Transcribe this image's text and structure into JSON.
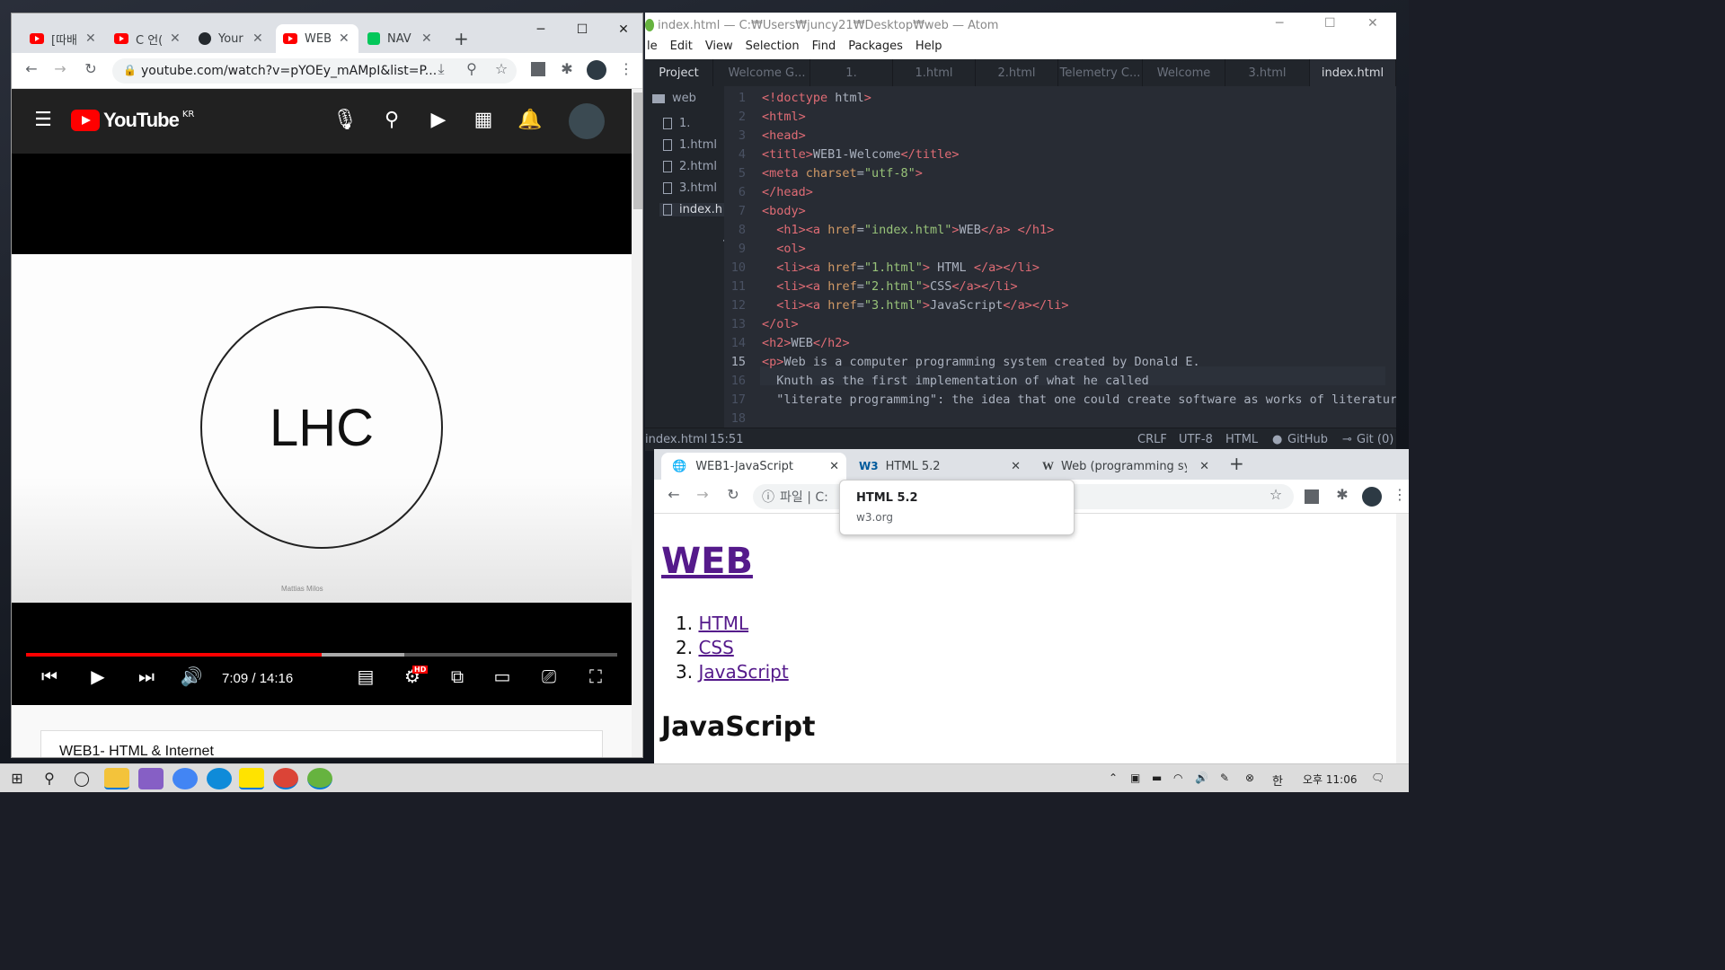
{
  "youtube_window": {
    "tabs": [
      {
        "label": "[따배",
        "fav_color": "#ff0000"
      },
      {
        "label": "C 언(",
        "fav_color": "#ff0000"
      },
      {
        "label": "Your",
        "fav_color": "#24292e"
      },
      {
        "label": "WEB",
        "fav_color": "#ff0000"
      },
      {
        "label": "NAV",
        "fav_color": "#03c75a"
      }
    ],
    "new_tab": "+",
    "url": "youtube.com/watch?v=pYOEy_mAMpI&list=P...",
    "logo_text": "YouTube",
    "logo_region": "KR",
    "slide_text": "LHC",
    "slide_credit": "Mattias Milos",
    "time_display": "7:09 / 14:16",
    "progress_fraction": 0.5,
    "buffered_fraction": 0.64,
    "hd_badge": "HD",
    "video_title": "WEB1- HTML & Internet"
  },
  "atom": {
    "title": "index.html — C:₩Users₩juncy21₩Desktop₩web — Atom",
    "menu": [
      "le",
      "Edit",
      "View",
      "Selection",
      "Find",
      "Packages",
      "Help"
    ],
    "project_tab": "Project",
    "tabs": [
      "Welcome G...",
      "1.",
      "1.html",
      "2.html",
      "Telemetry C...",
      "Welcome",
      "3.html",
      "index.html"
    ],
    "tree": {
      "root": "web",
      "files": [
        "1.",
        "1.html",
        "2.html",
        "3.html",
        "index.h"
      ]
    },
    "line_numbers": [
      "1",
      "2",
      "3",
      "4",
      "5",
      "6",
      "7",
      "8",
      "9",
      "10",
      "11",
      "12",
      "13",
      "14",
      "15",
      "16",
      "17",
      "18"
    ],
    "code_lines": [
      "<!doctype html>",
      "<html>",
      "<head>",
      "<title>WEB1-Welcome</title>",
      "<meta charset=\"utf-8\">",
      "</head>",
      "<body>",
      "  <h1><a href=\"index.html\">WEB</a> </h1>",
      "  <ol>",
      "  <li><a href=\"1.html\"> HTML </a></li>",
      "  <li><a href=\"2.html\">CSS</a></li>",
      "  <li><a href=\"3.html\">JavaScript</a></li>",
      "</ol>",
      "<h2>WEB</h2>",
      "<p>Web is a computer programming system created by Donald E.",
      "  Knuth as the first implementation of what he called",
      "  \"literate programming\": the idea that one could create software as works of literature",
      ""
    ],
    "status": {
      "file": "index.html",
      "cursor": "15:51",
      "line_ending": "CRLF",
      "encoding": "UTF-8",
      "grammar": "HTML",
      "github": "GitHub",
      "git": "Git (0)"
    }
  },
  "browser2": {
    "tabs": [
      {
        "label": "WEB1-JavaScript"
      },
      {
        "label": "HTML 5.2"
      },
      {
        "label": "Web (programming syste"
      }
    ],
    "omnibox_prefix": "파일 | C:",
    "tooltip": {
      "title": "HTML 5.2",
      "url": "w3.org"
    },
    "page": {
      "h1": "WEB",
      "list": [
        {
          "num": "1.",
          "text": "HTML"
        },
        {
          "num": "2.",
          "text": "CSS"
        },
        {
          "num": "3.",
          "text": "JavaScript"
        }
      ],
      "h2": "JavaScript"
    }
  },
  "taskbar": {
    "clock": "오후 11:06",
    "ime": "한"
  },
  "colors": {
    "youtube_red": "#ff0000",
    "atom_bg": "#282c34",
    "link_visited": "#551a8b"
  }
}
